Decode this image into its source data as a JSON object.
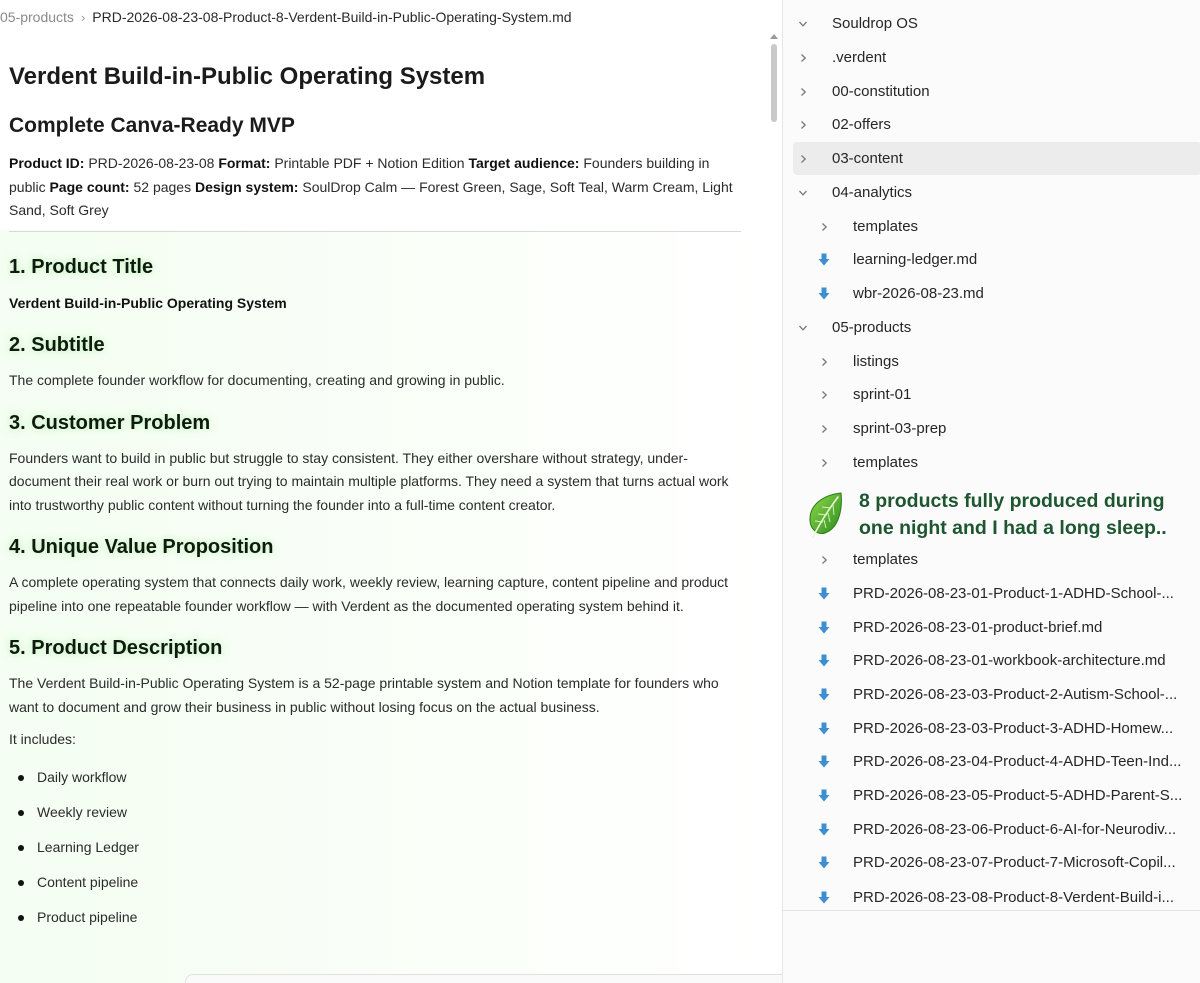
{
  "breadcrumb": {
    "folder": "05-products",
    "file": "PRD-2026-08-23-08-Product-8-Verdent-Build-in-Public-Operating-System.md"
  },
  "document": {
    "title": "Verdent Build-in-Public Operating System",
    "subtitle": "Complete Canva-Ready MVP",
    "meta": {
      "product_id_label": "Product ID:",
      "product_id": "PRD-2026-08-23-08",
      "format_label": "Format:",
      "format": "Printable PDF + Notion Edition",
      "audience_label": "Target audience:",
      "audience": "Founders building in public",
      "pages_label": "Page count:",
      "pages": "52 pages",
      "design_label": "Design system:",
      "design": "SoulDrop Calm — Forest Green, Sage, Soft Teal, Warm Cream, Light Sand, Soft Grey"
    },
    "sections": [
      {
        "heading": "1. Product Title",
        "body": "Verdent Build-in-Public Operating System"
      },
      {
        "heading": "2. Subtitle",
        "body": "The complete founder workflow for documenting, creating and growing in public."
      },
      {
        "heading": "3. Customer Problem",
        "body": "Founders want to build in public but struggle to stay consistent. They either overshare without strategy, under-document their real work or burn out trying to maintain multiple platforms. They need a system that turns actual work into trustworthy public content without turning the founder into a full-time content creator."
      },
      {
        "heading": "4. Unique Value Proposition",
        "body": "A complete operating system that connects daily work, weekly review, learning capture, content pipeline and product pipeline into one repeatable founder workflow — with Verdent as the documented operating system behind it."
      },
      {
        "heading": "5. Product Description",
        "body": "The Verdent Build-in-Public Operating System is a 52-page printable system and Notion template for founders who want to document and grow their business in public without losing focus on the actual business.",
        "intro": "It includes:"
      }
    ],
    "bullets": [
      "Daily workflow",
      "Weekly review",
      "Learning Ledger",
      "Content pipeline",
      "Product pipeline"
    ]
  },
  "explorer": {
    "rows": [
      {
        "label": "Souldrop OS",
        "icon": "chevron-down-icon"
      },
      {
        "label": ".verdent",
        "icon": "chevron-right-icon"
      },
      {
        "label": "00-constitution",
        "icon": "chevron-right-icon"
      },
      {
        "label": "02-offers",
        "icon": "chevron-right-icon"
      },
      {
        "label": "03-content",
        "icon": "chevron-right-icon"
      },
      {
        "label": "04-analytics",
        "icon": "chevron-down-icon"
      },
      {
        "label": "templates",
        "icon": "chevron-right-icon"
      },
      {
        "label": "learning-ledger.md",
        "icon": "download-arrow-icon"
      },
      {
        "label": "wbr-2026-08-23.md",
        "icon": "download-arrow-icon"
      },
      {
        "label": "05-products",
        "icon": "chevron-down-icon"
      },
      {
        "label": "listings",
        "icon": "chevron-right-icon"
      },
      {
        "label": "sprint-01",
        "icon": "chevron-right-icon"
      },
      {
        "label": "sprint-03-prep",
        "icon": "chevron-right-icon"
      },
      {
        "label": "templates",
        "icon": "chevron-right-icon"
      },
      {
        "label": "templates",
        "icon": "chevron-right-icon"
      },
      {
        "label": "PRD-2026-08-23-01-Product-1-ADHD-School-...",
        "icon": "download-arrow-icon"
      },
      {
        "label": "PRD-2026-08-23-01-product-brief.md",
        "icon": "download-arrow-icon"
      },
      {
        "label": "PRD-2026-08-23-01-workbook-architecture.md",
        "icon": "download-arrow-icon"
      },
      {
        "label": "PRD-2026-08-23-03-Product-2-Autism-School-...",
        "icon": "download-arrow-icon"
      },
      {
        "label": "PRD-2026-08-23-03-Product-3-ADHD-Homew...",
        "icon": "download-arrow-icon"
      },
      {
        "label": "PRD-2026-08-23-04-Product-4-ADHD-Teen-Ind...",
        "icon": "download-arrow-icon"
      },
      {
        "label": "PRD-2026-08-23-05-Product-5-ADHD-Parent-S...",
        "icon": "download-arrow-icon"
      },
      {
        "label": "PRD-2026-08-23-06-Product-6-AI-for-Neurodiv...",
        "icon": "download-arrow-icon"
      },
      {
        "label": "PRD-2026-08-23-07-Product-7-Microsoft-Copil...",
        "icon": "download-arrow-icon"
      },
      {
        "label": "PRD-2026-08-23-08-Product-8-Verdent-Build-i...",
        "icon": "download-arrow-icon"
      }
    ]
  },
  "overlay": {
    "line1": "8 products fully produced during",
    "line2": "one night and I had a long sleep..",
    "icon": "leaf-icon"
  },
  "colors": {
    "overlay_text": "#1e5631",
    "leaf": "#4caf28",
    "file_icon": "#3e8fd0",
    "heading_glow": "#82eb78"
  }
}
